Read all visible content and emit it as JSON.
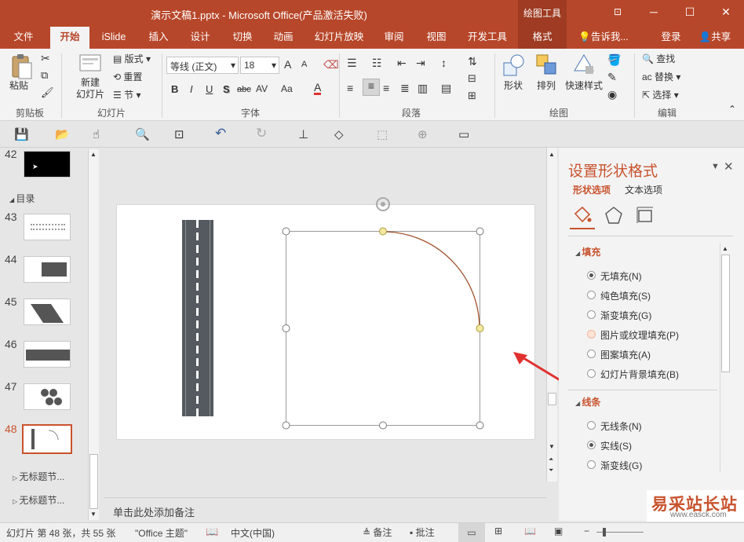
{
  "window": {
    "title": "演示文稿1.pptx - Microsoft Office(产品激活失败)",
    "contextual_tab_group": "绘图工具",
    "buttons": {
      "restore_icon": "⊡",
      "minimize": "─",
      "maximize": "☐",
      "close": "✕"
    }
  },
  "tabs": [
    "文件",
    "开始",
    "iSlide",
    "插入",
    "设计",
    "切换",
    "动画",
    "幻灯片放映",
    "审阅",
    "视图",
    "开发工具",
    "格式"
  ],
  "tab_right": {
    "tell_me": "告诉我...",
    "login": "登录",
    "share": "共享"
  },
  "ribbon": {
    "clipboard": {
      "paste": "粘贴",
      "label": "剪贴板"
    },
    "slides": {
      "new_slide": "新建\n幻灯片",
      "layout": "版式",
      "reset": "重置",
      "section": "节",
      "label": "幻灯片"
    },
    "font": {
      "font_name": "等线 (正文)",
      "font_size": "18",
      "bold": "B",
      "italic": "I",
      "underline": "U",
      "shadow": "S",
      "strike": "abc",
      "spacing": "AV",
      "case": "Aa",
      "color": "A",
      "grow": "A",
      "shrink": "A",
      "label": "字体"
    },
    "paragraph": {
      "label": "段落"
    },
    "drawing": {
      "shapes": "形状",
      "arrange": "排列",
      "quick_styles": "快速样式",
      "label": "绘图"
    },
    "editing": {
      "find": "查找",
      "replace": "替换",
      "select": "选择",
      "label": "编辑"
    }
  },
  "thumbnails": {
    "items": [
      {
        "num": "42"
      },
      {
        "num": "43"
      },
      {
        "num": "44"
      },
      {
        "num": "45"
      },
      {
        "num": "46"
      },
      {
        "num": "47"
      },
      {
        "num": "48"
      }
    ],
    "section_catalog": "目录",
    "sections": [
      "无标题节...",
      "无标题节..."
    ]
  },
  "notes_placeholder": "单击此处添加备注",
  "format_pane": {
    "title": "设置形状格式",
    "tab_shape": "形状选项",
    "tab_text": "文本选项",
    "fill_header": "填充",
    "fill_options": [
      {
        "label": "无填充(N)",
        "checked": true
      },
      {
        "label": "纯色填充(S)",
        "checked": false
      },
      {
        "label": "渐变填充(G)",
        "checked": false
      },
      {
        "label": "图片或纹理填充(P)",
        "checked": false
      },
      {
        "label": "图案填充(A)",
        "checked": false
      },
      {
        "label": "幻灯片背景填充(B)",
        "checked": false
      }
    ],
    "line_header": "线条",
    "line_options": [
      {
        "label": "无线条(N)",
        "checked": false
      },
      {
        "label": "实线(S)",
        "checked": true
      },
      {
        "label": "渐变线(G)",
        "checked": false
      }
    ]
  },
  "status": {
    "slide_info": "幻灯片 第 48 张，共 55 张",
    "theme": "\"Office 主题\"",
    "language": "中文(中国)",
    "notes": "备注",
    "comments": "批注"
  },
  "watermark": {
    "text": "易采站长站",
    "url": "www.easck.com"
  },
  "colors": {
    "accent": "#b7472a",
    "accent_dark": "#9e3b22",
    "arc": "#a0522d",
    "handle_yellow": "#f4e7a1",
    "arrow": "#e0312e"
  }
}
